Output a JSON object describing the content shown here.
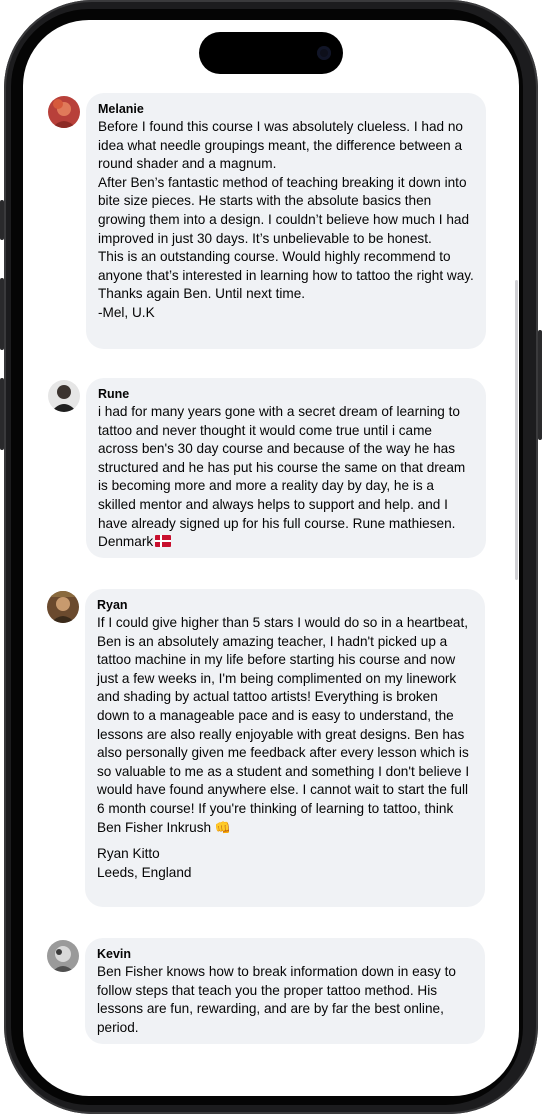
{
  "comments": [
    {
      "author": "Melanie",
      "avatar_icon": "profile-photo-red",
      "text": "Before I found this course I was absolutely clueless. I had no idea what needle groupings meant, the difference between a round shader and a magnum.\nAfter Ben’s fantastic method of teaching breaking it down into bite size pieces. He starts with the absolute basics then growing them into a design. I couldn’t believe how much I had improved in just 30 days. It’s unbelievable to be honest.\nThis is an outstanding course. Would highly recommend to anyone that’s interested in learning how to tattoo the right way. Thanks again Ben. Until next time.\n-Mel, U.K"
    },
    {
      "author": "Rune",
      "avatar_icon": "profile-photo-dark",
      "text": "i had for many years gone with a secret dream of learning to tattoo and never thought it would come true until i came across ben's 30 day course and because of the way he has structured and he has put his course the same on that dream is becoming more and more a reality day by day, he is a skilled mentor and always helps to support and help. and I have already signed up for his full course. Rune mathiesen. Denmark",
      "flag_icon": "denmark-flag-icon"
    },
    {
      "author": "Ryan",
      "avatar_icon": "profile-photo-brown",
      "text": "If I could give higher than 5 stars I would do so in a heartbeat, Ben is an absolutely amazing teacher, I hadn't picked up a tattoo machine in my life before starting his course and now just a few weeks in, I'm being complimented on my linework and shading by actual tattoo artists! Everything is broken down to a manageable pace and is easy to understand, the lessons are also really enjoyable with great designs. Ben has also personally given me feedback after every lesson which is so valuable to me as a student and something I don't believe I would have found anywhere else. I cannot wait to start the full 6 month course! If you're thinking of learning to tattoo, think Ben Fisher Inkrush",
      "emoji": "👊",
      "signature_name": "Ryan Kitto",
      "signature_place": "Leeds, England"
    },
    {
      "author": "Kevin",
      "avatar_icon": "profile-photo-grey",
      "text": "Ben Fisher knows how to break information down in easy to follow steps that teach you the proper tattoo method. His lessons are fun, rewarding, and are by far the best online, period."
    }
  ]
}
